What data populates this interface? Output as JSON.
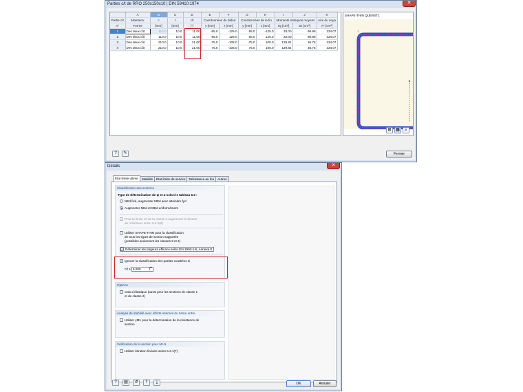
{
  "top_window": {
    "title": "Parties c/t de RRO 250x150x10 | DIN 59410:1974",
    "columns": {
      "letters": [
        "A",
        "B",
        "C",
        "D",
        "E",
        "F",
        "G",
        "H",
        "I",
        "J",
        "K"
      ],
      "row_header_line1": "Partie c/t",
      "row_header_line2": "n°",
      "headers1": [
        "Maintenu",
        "c",
        "t",
        "c/t",
        "Coordonnées du début",
        "",
        "Coordonnées de la fin",
        "",
        "Moments statiques moyens",
        "",
        "Aire du noya"
      ],
      "headers2": [
        "Forme",
        "[mm]",
        "[mm]",
        "[-]",
        "y [mm]",
        "z [mm]",
        "y [mm]",
        "z [mm]",
        "Sy [cm³]",
        "Sz [cm³]",
        "A* [cm²]"
      ]
    },
    "rows": [
      {
        "n": "1",
        "form": "Des deux côt",
        "c": "110.0",
        "t": "10.0",
        "ct": "11.00",
        "y1": "-55.0",
        "z1": "-125.0",
        "y2": "55.0",
        "z2": "-125.0",
        "sy": "33.00",
        "sz": "98.88",
        "a": "334.07"
      },
      {
        "n": "2",
        "form": "Des deux côt",
        "c": "110.0",
        "t": "10.0",
        "ct": "11.00",
        "y1": "-55.0",
        "z1": "125.0",
        "y2": "55.0",
        "z2": "125.0",
        "sy": "33.00",
        "sz": "98.88",
        "a": "334.07"
      },
      {
        "n": "3",
        "form": "Des deux côt",
        "c": "210.0",
        "t": "10.0",
        "ct": "21.00",
        "y1": "-75.0",
        "z1": "-105.0",
        "y2": "-75.0",
        "z2": "105.0",
        "sy": "129.82",
        "sz": "36.75",
        "a": "334.07"
      },
      {
        "n": "4",
        "form": "Des deux côt",
        "c": "210.0",
        "t": "10.0",
        "ct": "21.00",
        "y1": "75.0",
        "z1": "-105.0",
        "y2": "75.0",
        "z2": "105.0",
        "sy": "129.82",
        "sz": "36.75",
        "a": "334.07"
      }
    ],
    "graphic_label": "SHAPE-THIN QUERST1",
    "close_label": "Fermer",
    "icons": [
      "help-icon",
      "edit-icon",
      "print-icon",
      "export-icon",
      "info-icon"
    ]
  },
  "dialog": {
    "title": "Détails",
    "tabs": [
      "État limite ultime",
      "Stabilité",
      "État limite de service",
      "Résistance au feu",
      "Autres"
    ],
    "groups": {
      "classification": {
        "title": "Classification des sections",
        "type_label": "Type de détermination de ψ et α selon le tableau 5.2 :",
        "radio1": "NEd fixé, augmenter MEd pour atteindre fyd",
        "radio2": "Augmenter NEd et MEd uniformément",
        "greyed_line1": "Pour la limite c/t de la classe 3 augmenter le facteur",
        "greyed_line2": "de matériaux selon 5.5.2(9)",
        "shape_line1": "Utiliser SHAPE-THIN pour la classification",
        "shape_line2": "de tous les types de section supportés",
        "shape_line3": "(possibles seulement les classes 3 et 4)",
        "effective": "Déterminer les largeurs efficace selon EN 1993-1-5, Annexe E",
        "ignore": "Ignorer la classification des parties courbées si",
        "ct_label": "c/t ≤",
        "ct_value": "5.000"
      },
      "options": {
        "title": "Options",
        "line1": "Calcul élastique (aussi pour les sections de classe 1",
        "line2": "et de classe 2)"
      },
      "stability": {
        "title": "Analyse de stabilité avec efforts internes du 2ème ordre",
        "line1": "Utiliser γM1 pour la détermination de la résistance de",
        "line2": "section"
      },
      "verification": {
        "title": "Vérification de la section pour M+N",
        "line1": "Utiliser itération linéaire selon 6.2.1(7)"
      }
    },
    "ok_label": "OK",
    "cancel_label": "Annuler"
  }
}
